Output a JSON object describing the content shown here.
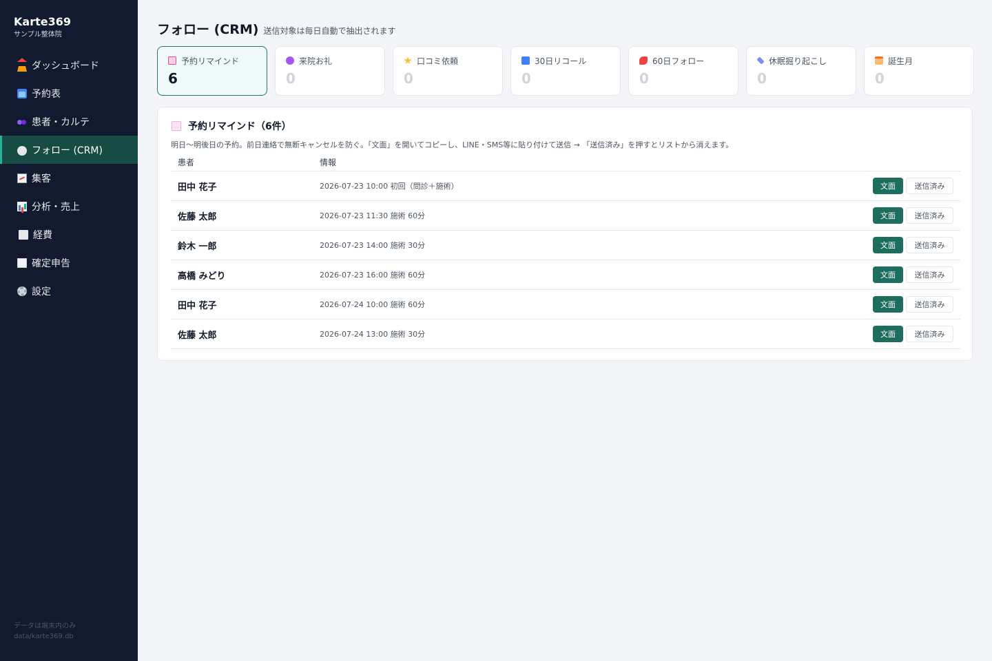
{
  "app": {
    "name": "Karte369",
    "subtitle": "サンプル整体院",
    "footer_line1": "データは端末内のみ",
    "footer_line2": "data/karte369.db"
  },
  "sidebar": {
    "items": [
      {
        "label": "ダッシュボード",
        "icon": "house-icon"
      },
      {
        "label": "予約表",
        "icon": "calendar-icon"
      },
      {
        "label": "患者・カルテ",
        "icon": "people-icon"
      },
      {
        "label": "フォロー (CRM)",
        "icon": "speech-bubble-icon",
        "active": true
      },
      {
        "label": "集客",
        "icon": "chart-up-icon"
      },
      {
        "label": "分析・売上",
        "icon": "bar-chart-icon"
      },
      {
        "label": "経費",
        "icon": "receipt-icon"
      },
      {
        "label": "確定申告",
        "icon": "document-icon"
      },
      {
        "label": "設定",
        "icon": "gear-icon"
      }
    ]
  },
  "header": {
    "title": "フォロー (CRM)",
    "subtitle": "送信対象は毎日自動で抽出されます"
  },
  "stats": [
    {
      "label": "予約リマインド",
      "count": "6",
      "icon": "inbox-icon",
      "color": "#ec4899",
      "active": true
    },
    {
      "label": "来院お礼",
      "count": "0",
      "icon": "people-icon",
      "color": "#a855f7"
    },
    {
      "label": "口コミ依頼",
      "count": "0",
      "icon": "star-icon",
      "color": "#f59e0b"
    },
    {
      "label": "30日リコール",
      "count": "0",
      "icon": "repeat-icon",
      "color": "#3b82f6"
    },
    {
      "label": "60日フォロー",
      "count": "0",
      "icon": "phone-icon",
      "color": "#ef4444"
    },
    {
      "label": "休眠掘り起こし",
      "count": "0",
      "icon": "pickaxe-icon",
      "color": "#6366f1"
    },
    {
      "label": "誕生月",
      "count": "0",
      "icon": "cake-icon",
      "color": "#f97316"
    }
  ],
  "section": {
    "title": "予約リマインド（6件）",
    "description": "明日〜明後日の予約。前日連絡で無断キャンセルを防ぐ。「文面」を開いてコピーし、LINE・SMS等に貼り付けて送信 → 「送信済み」を押すとリストから消えます。",
    "columns": {
      "patient": "患者",
      "info": "情報"
    },
    "text_button": "文面",
    "sent_button": "送信済み",
    "rows": [
      {
        "name": "田中 花子",
        "info": "2026-07-23 10:00 初回（問診＋施術）"
      },
      {
        "name": "佐藤 太郎",
        "info": "2026-07-23 11:30 施術 60分"
      },
      {
        "name": "鈴木 一郎",
        "info": "2026-07-23 14:00 施術 30分"
      },
      {
        "name": "高橋 みどり",
        "info": "2026-07-23 16:00 施術 60分"
      },
      {
        "name": "田中 花子",
        "info": "2026-07-24 10:00 施術 60分"
      },
      {
        "name": "佐藤 太郎",
        "info": "2026-07-24 13:00 施術 30分"
      }
    ]
  }
}
